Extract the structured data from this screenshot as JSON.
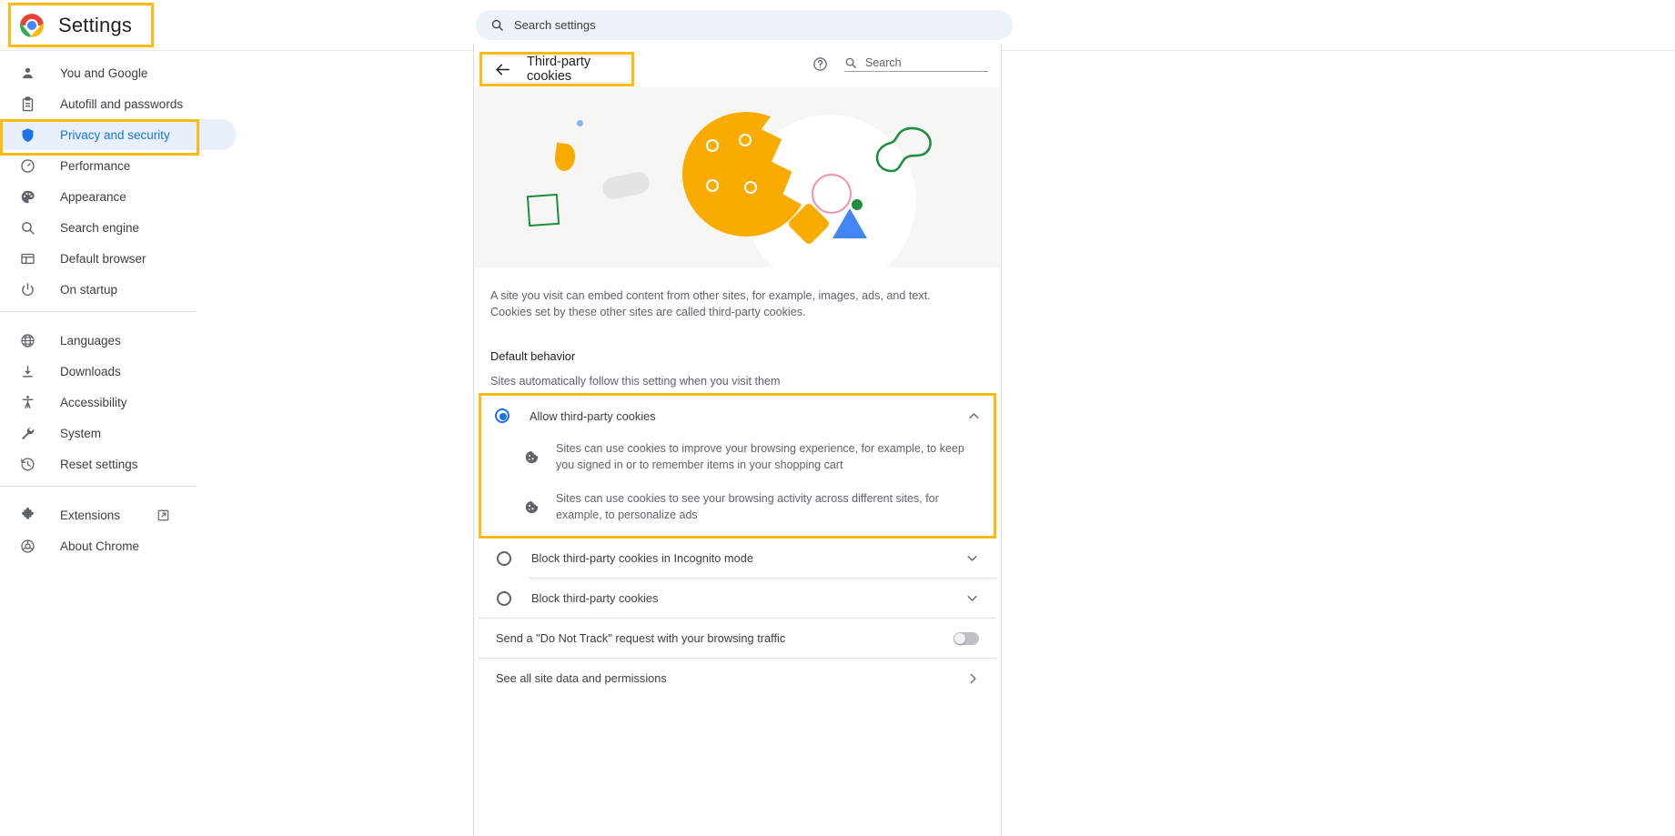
{
  "topbar": {
    "app_title": "Settings",
    "logo_icon": "chrome-logo",
    "search": {
      "icon": "search-icon",
      "placeholder": "Search settings",
      "value": ""
    }
  },
  "sidebar": {
    "group1": [
      {
        "label": "You and Google",
        "icon": "person-icon",
        "selected": false
      },
      {
        "label": "Autofill and passwords",
        "icon": "clipboard-icon",
        "selected": false
      },
      {
        "label": "Privacy and security",
        "icon": "shield-icon",
        "selected": true
      },
      {
        "label": "Performance",
        "icon": "speedometer-icon",
        "selected": false
      },
      {
        "label": "Appearance",
        "icon": "palette-icon",
        "selected": false
      },
      {
        "label": "Search engine",
        "icon": "magnifier-icon",
        "selected": false
      },
      {
        "label": "Default browser",
        "icon": "browser-window-icon",
        "selected": false
      },
      {
        "label": "On startup",
        "icon": "power-icon",
        "selected": false
      }
    ],
    "group2": [
      {
        "label": "Languages",
        "icon": "globe-icon",
        "selected": false
      },
      {
        "label": "Downloads",
        "icon": "download-icon",
        "selected": false
      },
      {
        "label": "Accessibility",
        "icon": "accessibility-icon",
        "selected": false
      },
      {
        "label": "System",
        "icon": "wrench-icon",
        "selected": false
      },
      {
        "label": "Reset settings",
        "icon": "history-restore-icon",
        "selected": false
      }
    ],
    "group3": [
      {
        "label": "Extensions",
        "icon": "puzzle-piece-icon",
        "external": true,
        "external_icon": "open-in-new-icon",
        "selected": false
      },
      {
        "label": "About Chrome",
        "icon": "chrome-outline-icon",
        "selected": false
      }
    ]
  },
  "main": {
    "back_icon": "back-arrow-icon",
    "heading": "Third-party cookies",
    "help_icon": "help-circle-icon",
    "search": {
      "icon": "search-icon",
      "placeholder": "Search",
      "label": "Search"
    },
    "illustration_icon": "cookie-illustration",
    "description": "A site you visit can embed content from other sites, for example, images, ads, and text. Cookies set by these other sites are called third-party cookies.",
    "section_title": "Default behavior",
    "section_subtitle": "Sites automatically follow this setting when you visit them",
    "options": [
      {
        "label": "Allow third-party cookies",
        "selected": true,
        "expanded": true,
        "chevron_icon": "chevron-up-icon",
        "bullets": [
          {
            "icon": "cookie-icon",
            "text": "Sites can use cookies to improve your browsing experience, for example, to keep you signed in or to remember items in your shopping cart"
          },
          {
            "icon": "cookie-icon",
            "text": "Sites can use cookies to see your browsing activity across different sites, for example, to personalize ads"
          }
        ]
      },
      {
        "label": "Block third-party cookies in Incognito mode",
        "selected": false,
        "expanded": false,
        "chevron_icon": "chevron-down-icon",
        "bullets": []
      },
      {
        "label": "Block third-party cookies",
        "selected": false,
        "expanded": false,
        "chevron_icon": "chevron-down-icon",
        "bullets": []
      }
    ],
    "do_not_track": {
      "label": "Send a \"Do Not Track\" request with your browsing traffic",
      "enabled": false,
      "control_icon": "toggle-switch-off"
    },
    "site_data_link": {
      "label": "See all site data and permissions",
      "arrow_icon": "chevron-right-icon"
    }
  },
  "colors": {
    "accent_blue": "#1a73e8",
    "highlight_yellow": "#FDBC12",
    "selected_bg": "#E8F0FE",
    "text_primary": "#202124",
    "text_secondary": "#5f6368"
  }
}
